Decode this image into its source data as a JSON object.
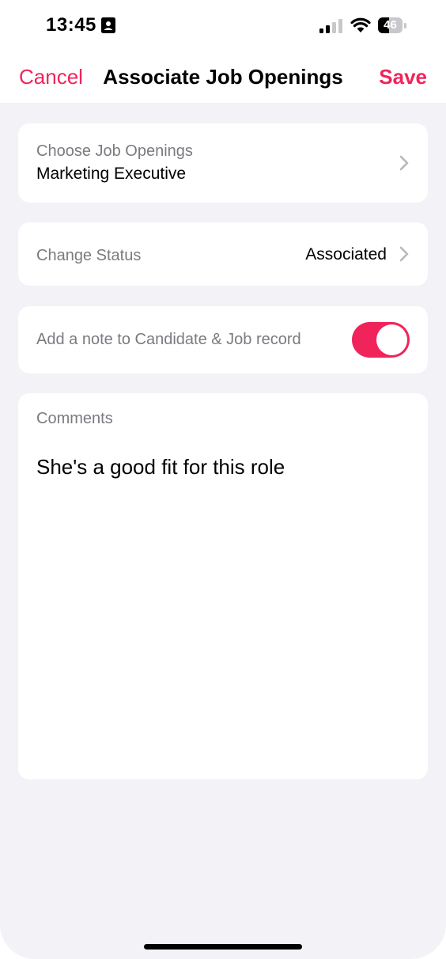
{
  "status_bar": {
    "time": "13:45",
    "contact_icon": "person-card-icon",
    "signal_icon": "cellular-signal-icon",
    "wifi_icon": "wifi-icon",
    "battery_level": 46,
    "battery_label": "46"
  },
  "nav": {
    "cancel_label": "Cancel",
    "title": "Associate Job Openings",
    "save_label": "Save",
    "accent_color": "#f0245a"
  },
  "job_openings": {
    "label": "Choose Job Openings",
    "value": "Marketing Executive",
    "chevron_icon": "chevron-right-icon"
  },
  "change_status": {
    "label": "Change Status",
    "value": "Associated",
    "chevron_icon": "chevron-right-icon"
  },
  "add_note": {
    "label": "Add a note to Candidate & Job record",
    "enabled": true,
    "toggle_color": "#f0245a"
  },
  "comments": {
    "label": "Comments",
    "text": "She's a good fit for this role"
  },
  "colors": {
    "background": "#f2f2f7",
    "card": "#ffffff",
    "accent": "#f0245a",
    "secondary_text": "#7a7a80"
  }
}
